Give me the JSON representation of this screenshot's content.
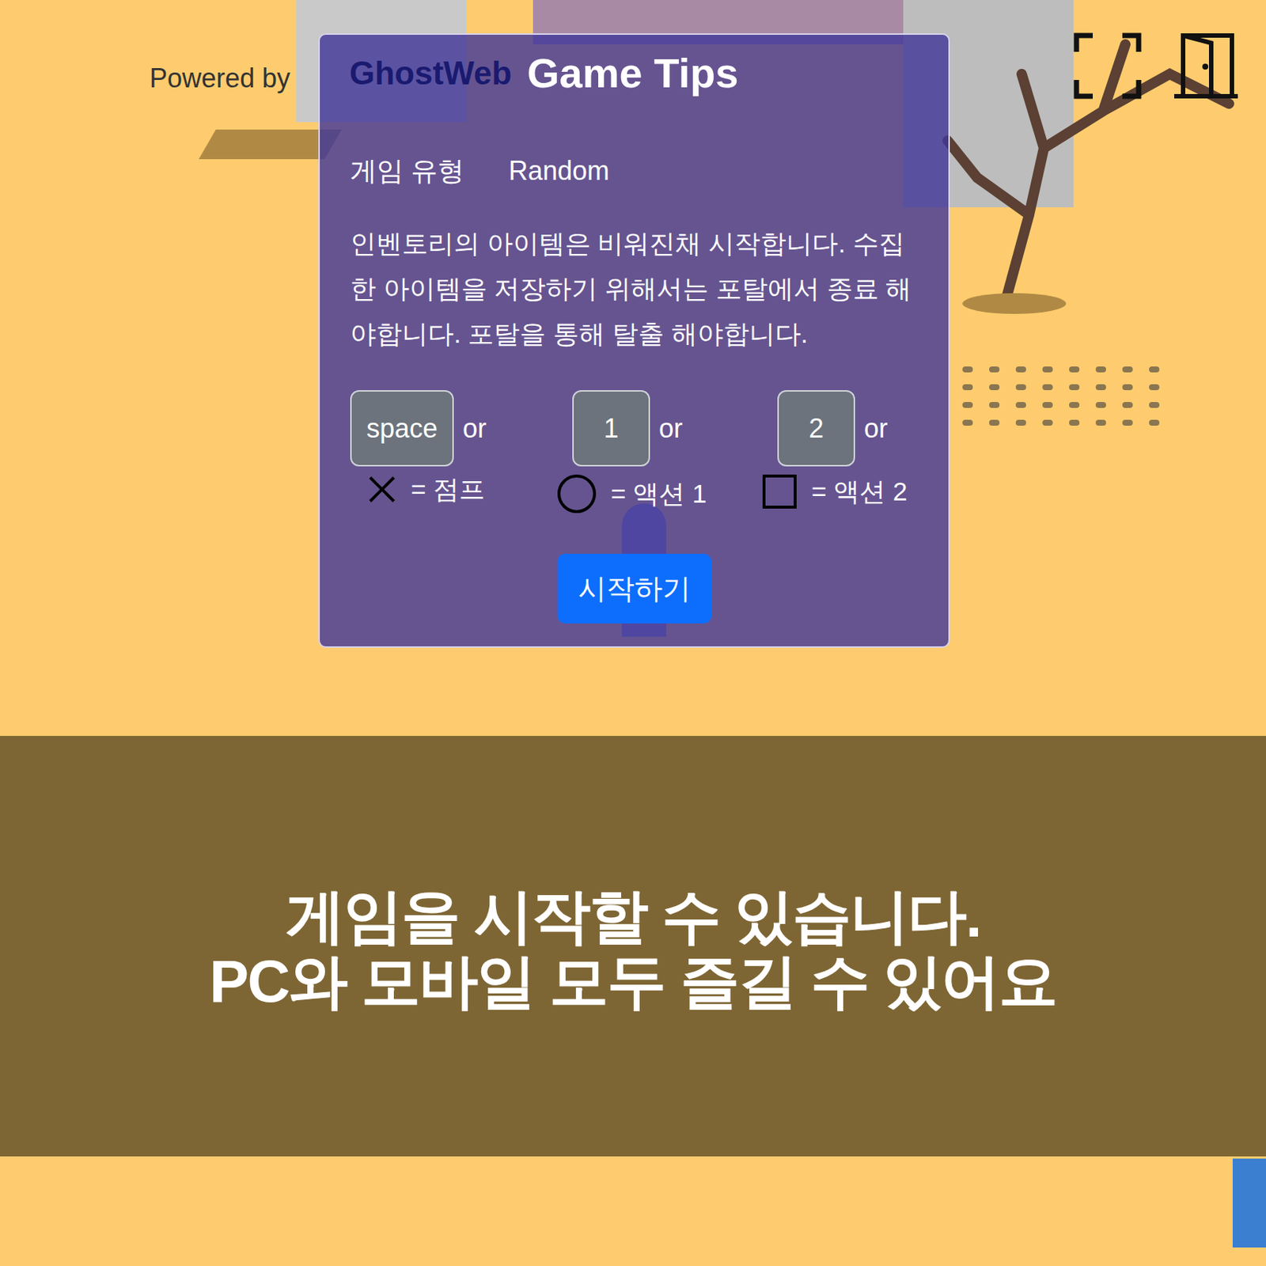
{
  "branding": {
    "prefix": "Powered by",
    "name": "GhostWeb"
  },
  "dialog": {
    "title": "Game Tips",
    "game_type": {
      "label": "게임 유형",
      "value": "Random"
    },
    "description": "인벤토리의 아이템은 비워진채 시작합니다. 수집한 아이템을 저장하기 위해서는 포탈에서 종료 해야합니다. 포탈을 통해 탈출 해야합니다.",
    "controls": [
      {
        "key": "space",
        "separator": "or",
        "action": "= 점프",
        "kind": "cross"
      },
      {
        "key": "1",
        "separator": "or",
        "action": "= 액션 1",
        "kind": "circle"
      },
      {
        "key": "2",
        "separator": "or",
        "action": "= 액션 2",
        "kind": "square"
      }
    ],
    "start_button": "시작하기"
  },
  "caption": [
    "게임을 시작할 수 있습니다.",
    "PC와 모바일 모두 즐길 수 있어요"
  ]
}
